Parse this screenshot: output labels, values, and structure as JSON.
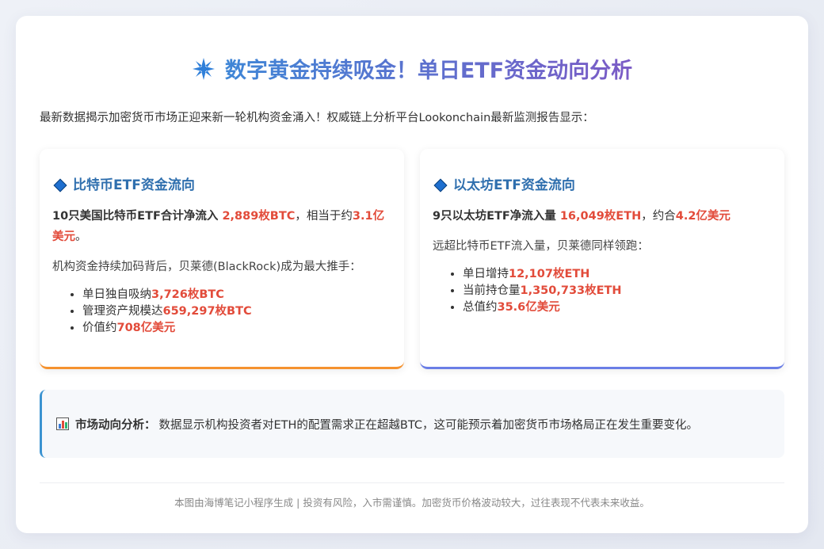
{
  "header": {
    "icon": "sparkle-icon",
    "title": "数字黄金持续吸金！单日ETF资金动向分析"
  },
  "intro": "最新数据揭示加密货币市场正迎来新一轮机构资金涌入！权威链上分析平台Lookonchain最新监测报告显示：",
  "btc": {
    "title": "比特币ETF资金流向",
    "lead_prefix": "10只美国比特币ETF合计净流入 ",
    "lead_amount": "2,889枚BTC",
    "lead_mid": "，相当于约",
    "lead_usd": "3.1亿美元",
    "lead_end": "。",
    "para": "机构资金持续加码背后，贝莱德(BlackRock)成为最大推手：",
    "items": [
      {
        "label": "单日独自吸纳",
        "value": "3,726枚BTC"
      },
      {
        "label": "管理资产规模达",
        "value": "659,297枚BTC"
      },
      {
        "label": "价值约",
        "value": "708亿美元"
      }
    ],
    "accent": "#f5922f"
  },
  "eth": {
    "title": "以太坊ETF资金流向",
    "lead_prefix": "9只以太坊ETF净流入量 ",
    "lead_amount": "16,049枚ETH",
    "lead_mid": "，约合",
    "lead_usd": "4.2亿美元",
    "para": "远超比特币ETF流入量，贝莱德同样领跑：",
    "items": [
      {
        "label": "单日增持",
        "value": "12,107枚ETH"
      },
      {
        "label": "当前持仓量",
        "value": "1,350,733枚ETH"
      },
      {
        "label": "总值约",
        "value": "35.6亿美元"
      }
    ],
    "accent": "#6a7ee6"
  },
  "analysis": {
    "icon": "bar-chart-icon",
    "label": "市场动向分析：",
    "text": "数据显示机构投资者对ETH的配置需求正在超越BTC，这可能预示着加密货币市场格局正在发生重要变化。"
  },
  "footer": "本图由海博笔记小程序生成 | 投资有风险，入市需谨慎。加密货币价格波动较大，过往表现不代表未来收益。",
  "colors": {
    "highlight": "#e24b3a",
    "panel_title": "#2f6fae"
  }
}
